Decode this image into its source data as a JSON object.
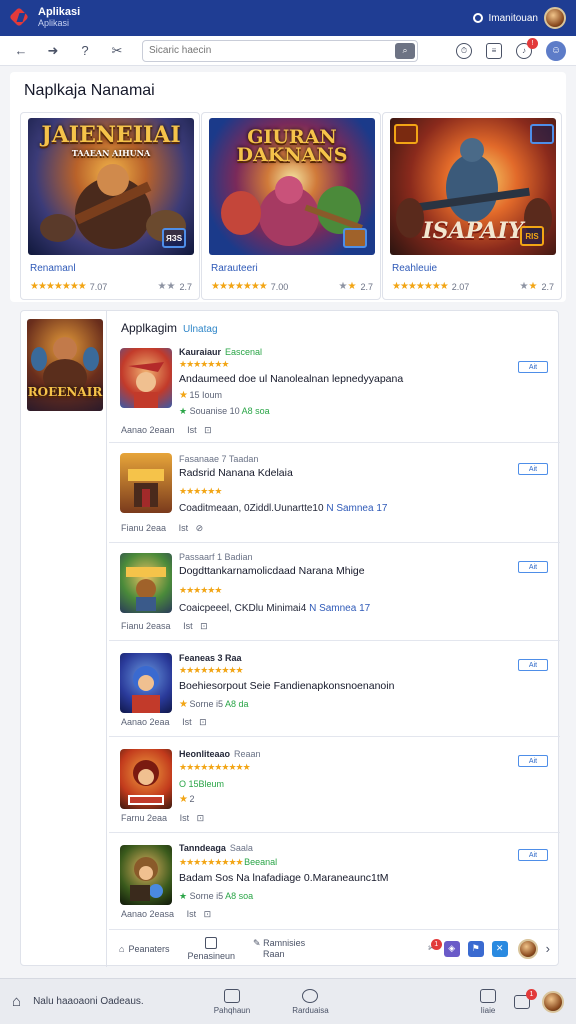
{
  "app": {
    "title": "Aplikasi",
    "subtitle": "Aplikasi"
  },
  "user": {
    "name": "Imanitouan"
  },
  "search": {
    "placeholder": "Sicaric haecin"
  },
  "page": {
    "title": "Naplkaja Nanamai"
  },
  "featured": [
    {
      "banner": "JAIENEIIAI",
      "sub": "TAAEAN AIHUNA",
      "badge": "ЯЗS",
      "name": "Renamanl",
      "score": "7.07",
      "score2": "2.7"
    },
    {
      "banner": "GIURAN DAKNANS",
      "sub": "",
      "badge": "",
      "name": "Rarauteeri",
      "score": "7.00",
      "score2": "2.7"
    },
    {
      "banner": "ISAPAIY",
      "sub": "",
      "badge": "RIS",
      "name": "Reahleuie",
      "score": "2.07",
      "score2": "2.7"
    }
  ],
  "sidebar": {
    "thumb_title": "ROEENAIR"
  },
  "list": {
    "title": "Applkagim",
    "tag": "Ulnatag",
    "items": [
      {
        "top": "Kauraiaur",
        "tag": "Eascenal",
        "desc": "Andaumeed doe ul Nanolealnan lepnedyyapana",
        "meta1": "15 Ioum",
        "meta2": "Souanise 10",
        "meta2g": "A8 soa",
        "foot": "Aanao 2eaan",
        "icons": "Ist",
        "btn": "Ait"
      },
      {
        "top": "Fasanaae 7 Taadan",
        "tag": "",
        "desc": "Radsrid Nanana Kdelaia",
        "meta1": "",
        "meta2": "Coaditmeaan, 0Ziddl.Uunartte10",
        "meta2g": "N Samnea 17",
        "foot": "Fianu 2eaa",
        "icons": "Ist",
        "btn": "Ait"
      },
      {
        "top": "Passaarf 1 Badian",
        "tag": "",
        "desc": "Dogdttankarnamolicdaad Narana Mhige",
        "meta1": "",
        "meta2": "Coaicpeeel, CKDlu Minimai4",
        "meta2g": "N Samnea 17",
        "foot": "Fianu 2easa",
        "icons": "Ist",
        "btn": "Ait"
      },
      {
        "top": "Feaneas 3 Raa",
        "tag": "",
        "desc": "Boehiesorpout Seie Fandienapkonsnoenanoin",
        "meta1": "",
        "meta2": "Sorne i5",
        "meta2g": "A8 da",
        "foot": "Aanao 2eaa",
        "icons": "Ist",
        "btn": "Ait"
      },
      {
        "top": "Heonliteaao",
        "tag": "Reaan",
        "desc": "",
        "meta1": "O 15Bleum",
        "meta2": "2",
        "meta2g": "",
        "foot": "Farnu 2eaa",
        "icons": "Ist",
        "btn": "Ait"
      },
      {
        "top": "Tanndeaga",
        "tag": "Beeanal",
        "desc": "Badam Sos Na lnafadiage 0.Maraneaunc1tM",
        "meta1": "",
        "meta2": "Sorne i5",
        "meta2g": "A8 soa",
        "foot": "Aanao 2easa",
        "icons": "Ist",
        "btn": "Ait"
      }
    ]
  },
  "tabs": [
    "Peanaters",
    "Penasineun",
    "Ramnisies"
  ],
  "tab_sub": "Raan",
  "bottom": {
    "left": "Nalu haaoaoni Oadeaus.",
    "items": [
      "Pahqhaun",
      "Rarduaisa",
      "Iiaie"
    ]
  },
  "colors": {
    "accent": "#1f3d93",
    "star": "#f2a515",
    "link": "#2f5ab8",
    "green": "#2aa547"
  }
}
